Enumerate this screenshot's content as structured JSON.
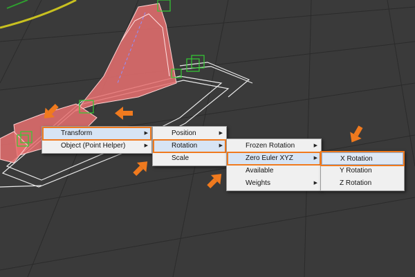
{
  "colors": {
    "background": "#3a3a3a",
    "grid_line": "#2a2a2a",
    "object_fill": "#e87070",
    "object_outline": "#ffffff",
    "helper_green": "#33cc33",
    "path_yellow": "#c8c020",
    "annotation_orange": "#f07a1e",
    "menu_bg": "#f0f0f0",
    "menu_highlight": "#d7e4f4"
  },
  "menus": {
    "main": {
      "items": [
        {
          "label": "Transform",
          "has_submenu": true
        },
        {
          "label": "Object (Point Helper)",
          "has_submenu": true
        }
      ]
    },
    "transform": {
      "items": [
        {
          "label": "Position",
          "has_submenu": true
        },
        {
          "label": "Rotation",
          "has_submenu": true
        },
        {
          "label": "Scale",
          "has_submenu": false
        }
      ]
    },
    "rotation": {
      "items": [
        {
          "label": "Frozen Rotation",
          "has_submenu": true
        },
        {
          "label": "Zero Euler XYZ",
          "has_submenu": true
        },
        {
          "label": "Available",
          "has_submenu": false
        },
        {
          "label": "Weights",
          "has_submenu": true
        }
      ]
    },
    "euler": {
      "items": [
        {
          "label": "X Rotation",
          "has_submenu": false
        },
        {
          "label": "Y Rotation",
          "has_submenu": false
        },
        {
          "label": "Z Rotation",
          "has_submenu": false
        }
      ]
    }
  },
  "icons": {
    "submenu_arrow": "▶",
    "annotation": "orange-arrow-icon"
  }
}
